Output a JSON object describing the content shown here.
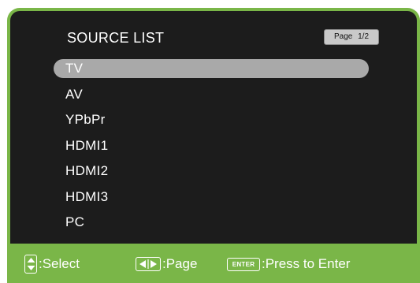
{
  "menu": {
    "title": "SOURCE LIST",
    "page_label": "Page 1/2",
    "items": [
      {
        "label": "TV",
        "selected": true
      },
      {
        "label": "AV",
        "selected": false
      },
      {
        "label": "YPbPr",
        "selected": false
      },
      {
        "label": "HDMI1",
        "selected": false
      },
      {
        "label": "HDMI2",
        "selected": false
      },
      {
        "label": "HDMI3",
        "selected": false
      },
      {
        "label": "PC",
        "selected": false
      }
    ]
  },
  "footer": {
    "select_label": ":Select",
    "select_icon": "up-down-arrows-icon",
    "page_label": ":Page",
    "page_icon": "left-right-arrows-icon",
    "enter_key": "ENTER",
    "enter_label": ":Press to Enter"
  },
  "colors": {
    "frame_green": "#7ab648",
    "panel_dark": "#1c1c1c",
    "highlight_gray": "#a9a9a9"
  }
}
